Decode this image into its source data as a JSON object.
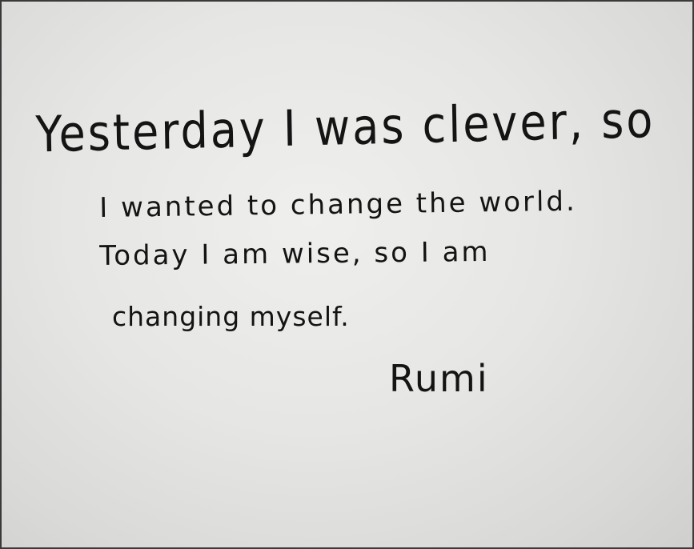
{
  "whiteboard": {
    "lines": [
      "Yesterday I was clever, so",
      "I wanted to change the world.",
      "Today I am wise, so I am",
      "changing myself."
    ],
    "signature": "Rumi"
  }
}
